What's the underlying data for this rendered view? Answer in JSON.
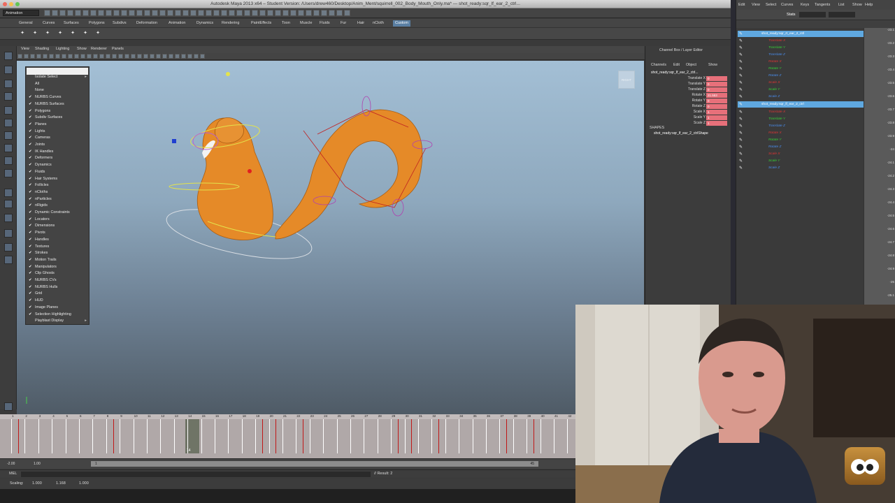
{
  "window": {
    "title": "Autodesk Maya 2013 x64 – Student Version: /Users/drew460/Desktop/Anim_Ment/squirrell_002_Body_Mouth_Only.ma*   ---   shot_ready:sqr_lf_ear_2_ctrl..."
  },
  "status_line": {
    "mode": "Animation"
  },
  "shelf_tabs": [
    "General",
    "Curves",
    "Surfaces",
    "Polygons",
    "Subdivs",
    "Deformation",
    "Animation",
    "Dynamics",
    "Rendering",
    "PaintEffects",
    "Toon",
    "Muscle",
    "Fluids",
    "Fur",
    "Hair",
    "nCloth",
    "Custom"
  ],
  "active_shelf_tab": "Custom",
  "panel_menu": [
    "View",
    "Shading",
    "Lighting",
    "Show",
    "Renderer",
    "Panels"
  ],
  "show_menu": {
    "items": [
      {
        "label": "Isolate Select",
        "check": false,
        "submenu": true
      },
      {
        "label": "All",
        "check": false
      },
      {
        "label": "None",
        "check": false
      },
      {
        "label": "NURBS Curves",
        "check": true
      },
      {
        "label": "NURBS Surfaces",
        "check": true
      },
      {
        "label": "Polygons",
        "check": true
      },
      {
        "label": "Subdiv Surfaces",
        "check": true
      },
      {
        "label": "Planes",
        "check": true
      },
      {
        "label": "Lights",
        "check": true
      },
      {
        "label": "Cameras",
        "check": true
      },
      {
        "label": "Joints",
        "check": true
      },
      {
        "label": "IK Handles",
        "check": true
      },
      {
        "label": "Deformers",
        "check": true
      },
      {
        "label": "Dynamics",
        "check": true
      },
      {
        "label": "Fluids",
        "check": true
      },
      {
        "label": "Hair Systems",
        "check": true
      },
      {
        "label": "Follicles",
        "check": true
      },
      {
        "label": "nCloths",
        "check": true
      },
      {
        "label": "nParticles",
        "check": true
      },
      {
        "label": "nRigids",
        "check": true
      },
      {
        "label": "Dynamic Constraints",
        "check": true
      },
      {
        "label": "Locators",
        "check": true
      },
      {
        "label": "Dimensions",
        "check": true
      },
      {
        "label": "Pivots",
        "check": true
      },
      {
        "label": "Handles",
        "check": true
      },
      {
        "label": "Textures",
        "check": true
      },
      {
        "label": "Strokes",
        "check": true
      },
      {
        "label": "Motion Trails",
        "check": true
      },
      {
        "label": "Manipulators",
        "check": true
      },
      {
        "label": "Clip Ghosts",
        "check": true
      },
      {
        "label": "NURBS CVs",
        "check": true
      },
      {
        "label": "NURBS Hulls",
        "check": true
      },
      {
        "label": "Grid",
        "check": true
      },
      {
        "label": "HUD",
        "check": true
      },
      {
        "label": "Image Planes",
        "check": true
      },
      {
        "label": "Selection Highlighting",
        "check": true
      },
      {
        "label": "Playblast Display",
        "check": false,
        "submenu": true
      }
    ]
  },
  "viewcube_label": "RIGHT",
  "channel_box": {
    "title": "Channel Box / Layer Editor",
    "menus": [
      "Channels",
      "Edit",
      "Object",
      "Show"
    ],
    "object_name": "shot_ready:sqr_lf_ear_2_ctrl...",
    "attributes": [
      {
        "label": "Translate X",
        "value": "0"
      },
      {
        "label": "Translate Y",
        "value": "0"
      },
      {
        "label": "Translate Z",
        "value": "0"
      },
      {
        "label": "Rotate X",
        "value": "21.553"
      },
      {
        "label": "Rotate Y",
        "value": "0"
      },
      {
        "label": "Rotate Z",
        "value": "0"
      },
      {
        "label": "Scale X",
        "value": "1"
      },
      {
        "label": "Scale Y",
        "value": "1"
      },
      {
        "label": "Scale Z",
        "value": "1"
      }
    ],
    "shapes_header": "SHAPES",
    "shape_name": "shot_ready:sqr_lf_ear_2_ctrlShape"
  },
  "graph_editor": {
    "menus": [
      "Edit",
      "View",
      "Select",
      "Curves",
      "Keys",
      "Tangents",
      "List",
      "Show",
      "Help"
    ],
    "stats_label": "Stats",
    "outline": [
      {
        "label": "shot_ready:sqr_rt_ear_2_ctrl",
        "selected": true,
        "color": "#ffffff"
      },
      {
        "label": "Translate X",
        "color": "#e03434"
      },
      {
        "label": "Translate Y",
        "color": "#35d235"
      },
      {
        "label": "Translate Z",
        "color": "#4a8ff0"
      },
      {
        "label": "Rotate X",
        "color": "#e03434"
      },
      {
        "label": "Rotate Y",
        "color": "#35d235"
      },
      {
        "label": "Rotate Z",
        "color": "#4a8ff0"
      },
      {
        "label": "Scale X",
        "color": "#e03434"
      },
      {
        "label": "Scale Y",
        "color": "#35d235"
      },
      {
        "label": "Scale Z",
        "color": "#4a8ff0"
      },
      {
        "label": "shot_ready:sqr_lf_ear_2_ctrl",
        "selected": true,
        "color": "#ffffff"
      },
      {
        "label": "Translate X",
        "color": "#e03434"
      },
      {
        "label": "Translate Y",
        "color": "#35d235"
      },
      {
        "label": "Translate Z",
        "color": "#4a8ff0"
      },
      {
        "label": "Rotate X",
        "color": "#e03434"
      },
      {
        "label": "Rotate Y",
        "color": "#35d235"
      },
      {
        "label": "Rotate Z",
        "color": "#4a8ff0"
      },
      {
        "label": "Scale X",
        "color": "#e03434"
      },
      {
        "label": "Scale Y",
        "color": "#35d235"
      },
      {
        "label": "Scale Z",
        "color": "#4a8ff0"
      }
    ],
    "y_ticks": [
      "-23.1",
      "-23.2",
      "-23.3",
      "-23.4",
      "-23.5",
      "-23.6",
      "-23.7",
      "-23.8",
      "-23.9",
      "-24",
      "-24.1",
      "-24.2",
      "-24.3",
      "-24.4",
      "-24.5",
      "-24.6",
      "-24.7",
      "-24.8",
      "-24.9",
      "-25",
      "-25.1"
    ]
  },
  "timeline": {
    "frame_numbers": [
      "1",
      "2",
      "3",
      "4",
      "5",
      "6",
      "7",
      "8",
      "9",
      "10",
      "11",
      "12",
      "13",
      "14",
      "15",
      "16",
      "17",
      "18",
      "19",
      "20",
      "21",
      "22",
      "23",
      "24",
      "25",
      "26",
      "27",
      "28",
      "29",
      "30",
      "31",
      "32",
      "33",
      "34",
      "35",
      "36",
      "37",
      "38",
      "39",
      "40",
      "41",
      "42"
    ],
    "current_frame": "14",
    "key_frames": [
      1,
      8,
      19,
      20,
      22,
      29,
      30,
      32,
      37,
      39
    ]
  },
  "range_slider": {
    "start": "-2.00",
    "inner_start": "1.00",
    "handle_label": "1",
    "inner_end": "45"
  },
  "command_line": {
    "label": "MEL",
    "result": "// Result: 2"
  },
  "help_line": {
    "scaling_label": "Scaling:",
    "values": [
      "1.000",
      "1.168",
      "1.000"
    ]
  },
  "colors": {
    "selection_blue": "#5fa8e0",
    "channel_key_red": "#e7707a",
    "shelf_active": "#5a7fa3"
  }
}
